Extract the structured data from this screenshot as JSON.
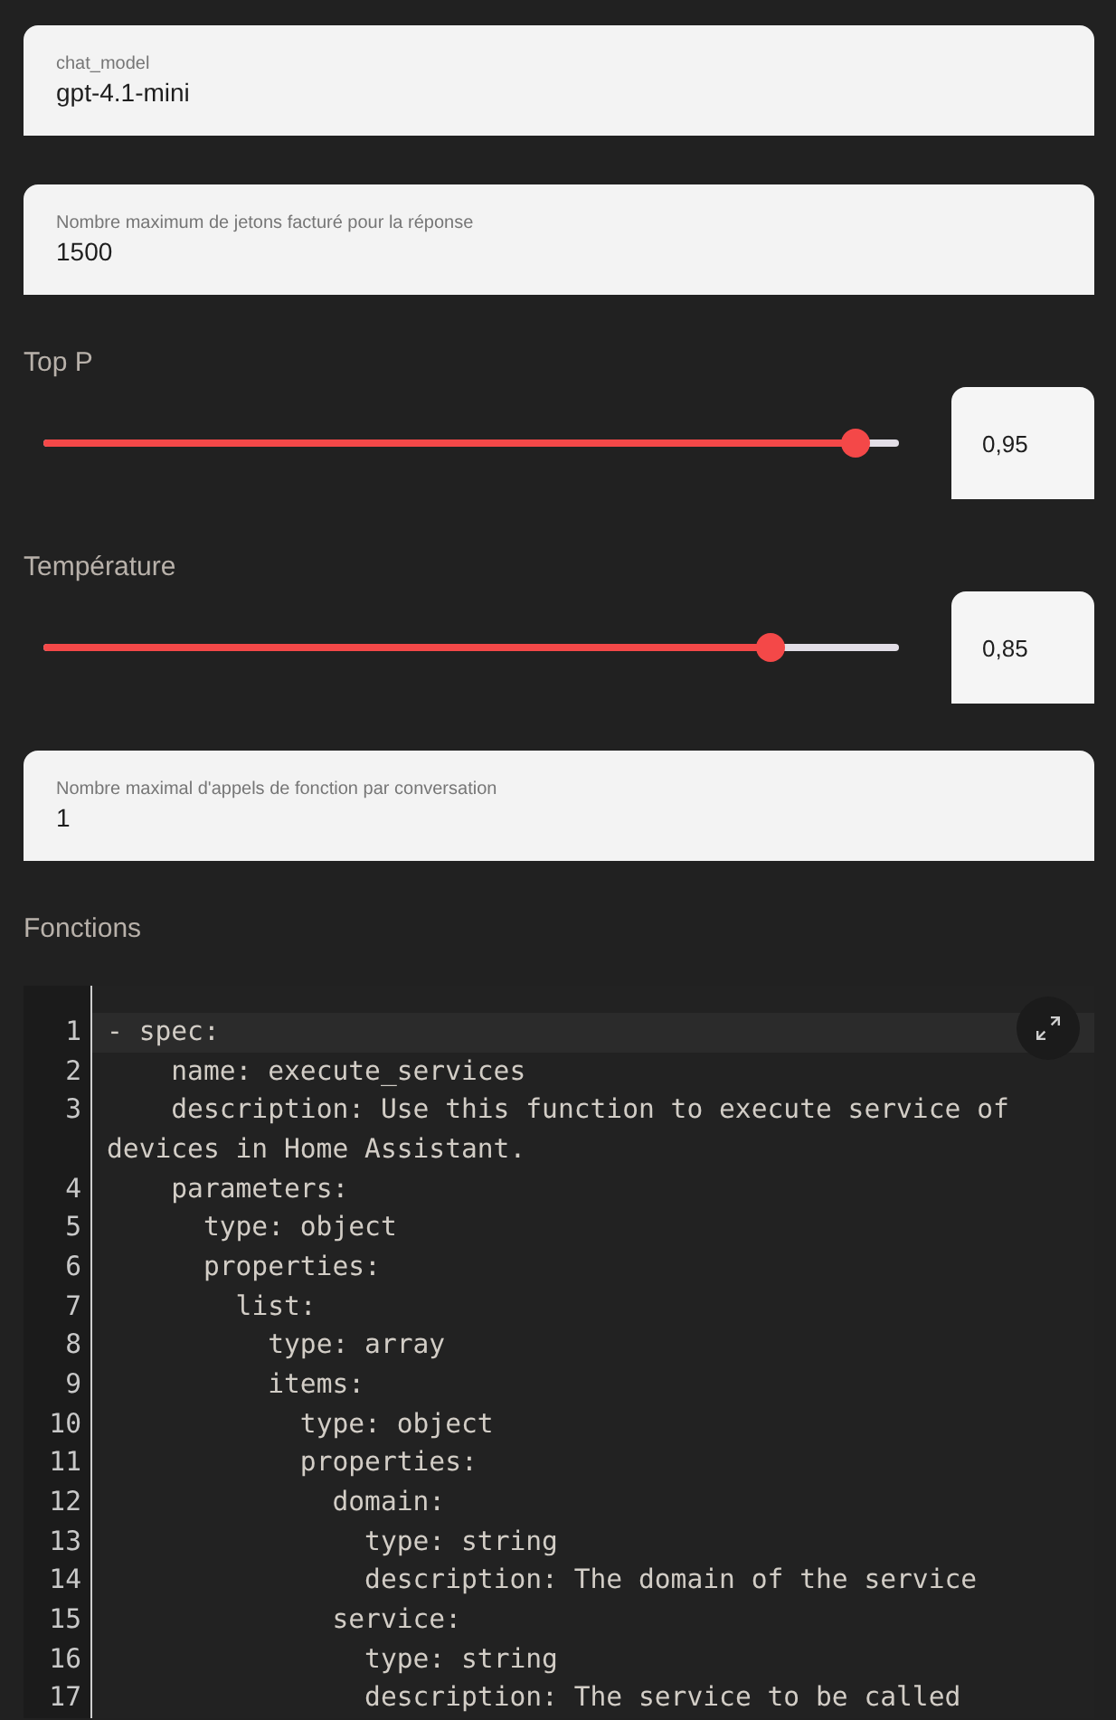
{
  "settings": [
    {
      "kind": "text_field",
      "label": "chat_model",
      "value": "gpt-4.1-mini"
    },
    {
      "kind": "text_field",
      "label": "Nombre maximum de jetons facturé pour la réponse",
      "value": "1500"
    },
    {
      "kind": "slider",
      "label": "Top P",
      "level": 0.95,
      "value": "0,95"
    },
    {
      "kind": "slider",
      "label": "Température",
      "level": 0.85,
      "value": "0,85"
    },
    {
      "kind": "text_field",
      "label": "Nombre maximal d'appels de fonction par conversation",
      "value": "1"
    }
  ],
  "functions": {
    "title": "Fonctions",
    "lines": [
      {
        "number": "1",
        "text": "- spec:",
        "active": true
      },
      {
        "number": "2",
        "text": "    name: execute_services",
        "active": false
      },
      {
        "number": "3",
        "text": "    description: Use this function to execute service of devices in Home Assistant.",
        "active": false
      },
      {
        "number": "4",
        "text": "    parameters:",
        "active": false
      },
      {
        "number": "5",
        "text": "      type: object",
        "active": false
      },
      {
        "number": "6",
        "text": "      properties:",
        "active": false
      },
      {
        "number": "7",
        "text": "        list:",
        "active": false
      },
      {
        "number": "8",
        "text": "          type: array",
        "active": false
      },
      {
        "number": "9",
        "text": "          items:",
        "active": false
      },
      {
        "number": "10",
        "text": "            type: object",
        "active": false
      },
      {
        "number": "11",
        "text": "            properties:",
        "active": false
      },
      {
        "number": "12",
        "text": "              domain:",
        "active": false
      },
      {
        "number": "13",
        "text": "                type: string",
        "active": false
      },
      {
        "number": "14",
        "text": "                description: The domain of the service",
        "active": false
      },
      {
        "number": "15",
        "text": "              service:",
        "active": false
      },
      {
        "number": "16",
        "text": "                type: string",
        "active": false
      },
      {
        "number": "17",
        "text": "                description: The service to be called",
        "active": false
      }
    ]
  }
}
